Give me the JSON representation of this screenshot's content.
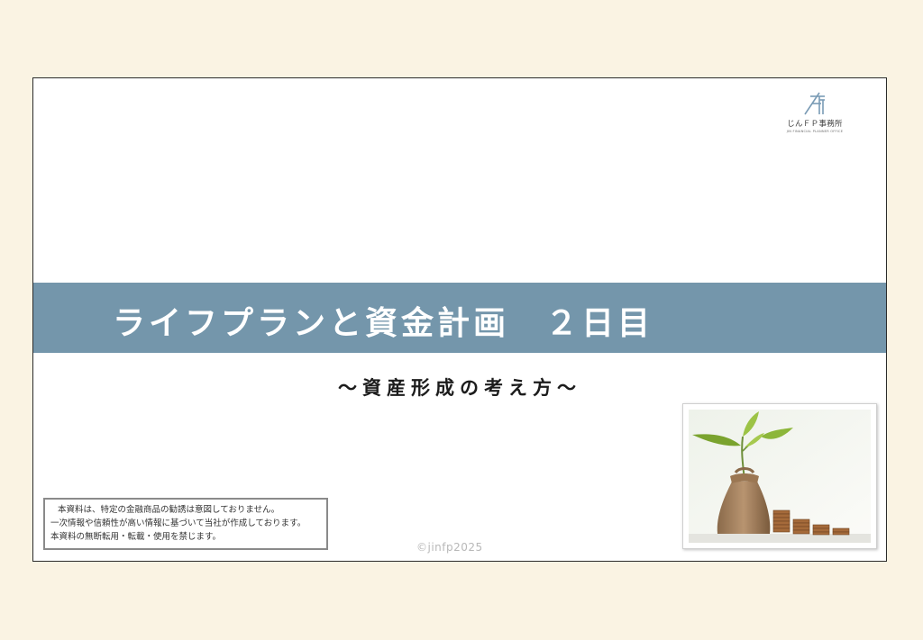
{
  "slide": {
    "logo": {
      "icon": "jfp-logo-mark",
      "name": "じんＦＰ事務所",
      "subname": "JIN FINANCIAL PLANNER OFFICE"
    },
    "title": "ライフプランと資金計画　２日目",
    "subtitle": "～資産形成の考え方～",
    "notice": {
      "line1": "本資料は、特定の金融商品の勧誘は意図しておりません。",
      "line2": "一次情報や信頼性が高い情報に基づいて当社が作成しております。",
      "line3": "本資料の無断転用・転載・使用を禁じます。"
    },
    "copyright": "©jinfp2025",
    "image": "plant-coins-photo"
  },
  "colors": {
    "background": "#faf3e3",
    "title_band": "#7496ab",
    "title_text": "#ffffff"
  }
}
